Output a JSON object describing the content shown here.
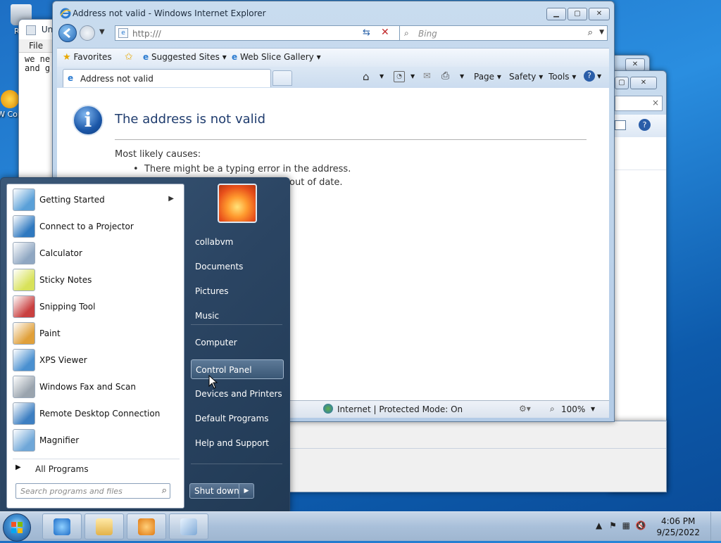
{
  "desktop": {
    "icons": [
      {
        "label": "Rec"
      },
      {
        "label": "W Con"
      }
    ]
  },
  "notepad": {
    "title": "Unt",
    "menu_file": "File",
    "text_line1": "we ne",
    "text_line2": "and g"
  },
  "ie": {
    "title": "Address not valid - Windows Internet Explorer",
    "address": "http:///",
    "search_placeholder": "Bing",
    "favorites": {
      "label": "Favorites",
      "items": [
        "Suggested Sites",
        "Web Slice Gallery"
      ]
    },
    "tab_label": "Address not valid",
    "commands": {
      "page": "Page",
      "safety": "Safety",
      "tools": "Tools"
    },
    "error": {
      "title": "The address is not valid",
      "causes_heading": "Most likely causes:",
      "bullets": [
        "There might be a typing error in the address.",
        "out of date."
      ]
    },
    "status": {
      "zone": "Internet | Protected Mode: On",
      "zoom": "100%"
    }
  },
  "start_menu": {
    "programs": [
      {
        "label": "Getting Started",
        "submenu": true,
        "icon": "getting-started-icon",
        "color": "#5aa0d8"
      },
      {
        "label": "Connect to a Projector",
        "submenu": false,
        "icon": "projector-icon",
        "color": "#2f79c0"
      },
      {
        "label": "Calculator",
        "submenu": false,
        "icon": "calculator-icon",
        "color": "#8fa7c2"
      },
      {
        "label": "Sticky Notes",
        "submenu": false,
        "icon": "sticky-notes-icon",
        "color": "#d8e25a"
      },
      {
        "label": "Snipping Tool",
        "submenu": false,
        "icon": "scissors-icon",
        "color": "#c94040"
      },
      {
        "label": "Paint",
        "submenu": false,
        "icon": "paint-icon",
        "color": "#e0a03a"
      },
      {
        "label": "XPS Viewer",
        "submenu": false,
        "icon": "xps-viewer-icon",
        "color": "#4a90d0"
      },
      {
        "label": "Windows Fax and Scan",
        "submenu": false,
        "icon": "fax-icon",
        "color": "#9aa4ae"
      },
      {
        "label": "Remote Desktop Connection",
        "submenu": false,
        "icon": "remote-desktop-icon",
        "color": "#3d7fc2"
      },
      {
        "label": "Magnifier",
        "submenu": false,
        "icon": "magnifier-icon",
        "color": "#6fa7d8"
      }
    ],
    "all_programs": "All Programs",
    "search_placeholder": "Search programs and files",
    "right_items": [
      {
        "label": "collabvm"
      },
      {
        "label": "Documents"
      },
      {
        "label": "Pictures"
      },
      {
        "label": "Music"
      },
      {
        "label": "Computer"
      },
      {
        "label": "Control Panel",
        "hover": true
      },
      {
        "label": "Devices and Printers"
      },
      {
        "label": "Default Programs"
      },
      {
        "label": "Help and Support"
      }
    ],
    "shutdown": "Shut down"
  },
  "taskbar": {
    "items": [
      "internet-explorer-icon",
      "folder-icon",
      "media-player-icon",
      "notepad-icon"
    ],
    "time": "4:06 PM",
    "date": "9/25/2022"
  }
}
